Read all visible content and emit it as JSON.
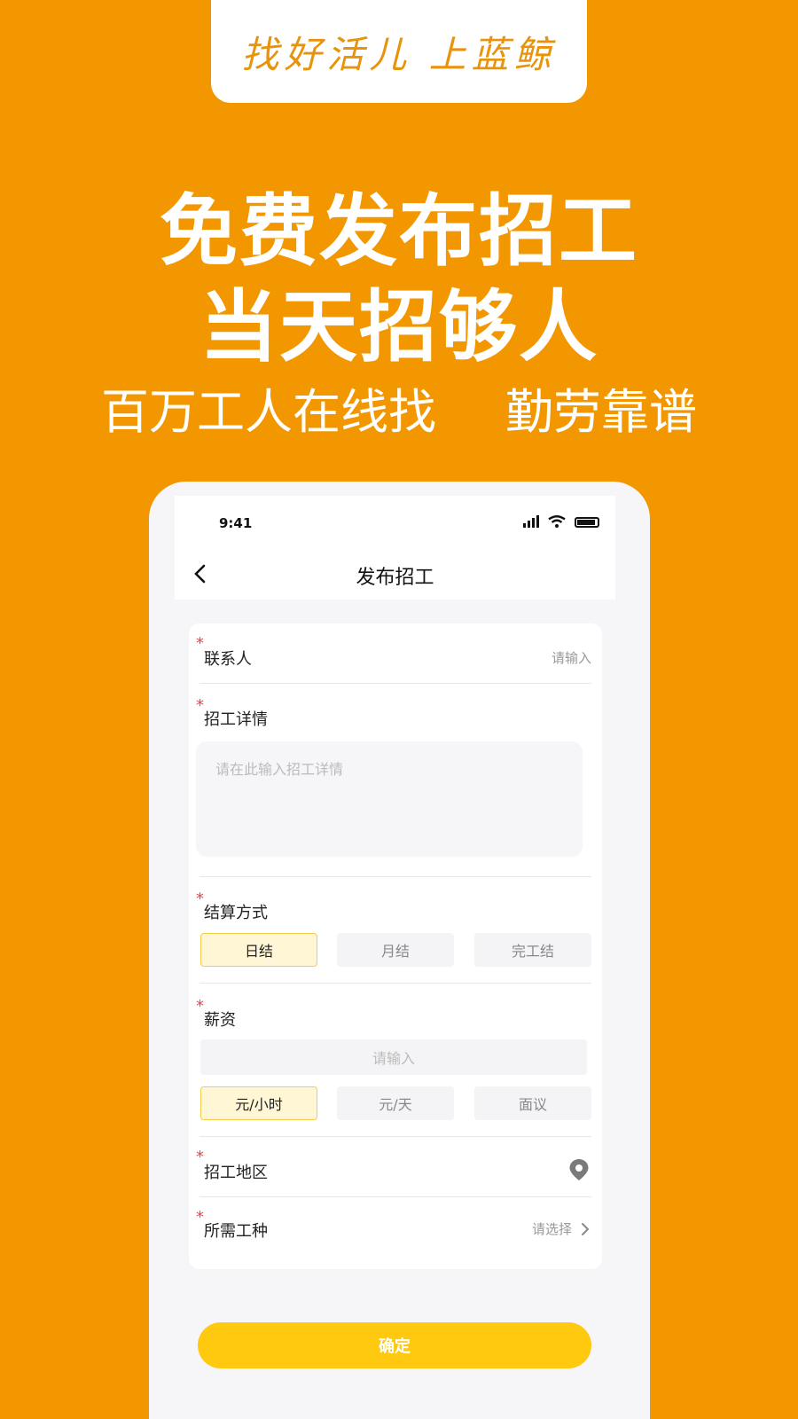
{
  "banner": {
    "slogan": "找好活儿 上蓝鲸",
    "headline_1": "免费发布招工",
    "headline_2": "当天招够人",
    "subline_left": "百万工人在线找",
    "subline_right": "勤劳靠谱"
  },
  "status_bar": {
    "time": "9:41",
    "icons": [
      "signal-icon",
      "wifi-icon",
      "battery-icon"
    ]
  },
  "nav": {
    "title": "发布招工",
    "back_icon": "chevron-left-icon"
  },
  "form": {
    "contact": {
      "label": "联系人",
      "placeholder": "请输入",
      "required_mark": "*"
    },
    "details": {
      "label": "招工详情",
      "placeholder": "请在此输入招工详情",
      "required_mark": "*"
    },
    "settlement": {
      "label": "结算方式",
      "required_mark": "*",
      "options": [
        "日结",
        "月结",
        "完工结"
      ],
      "selected": "日结"
    },
    "salary": {
      "label": "薪资",
      "required_mark": "*",
      "placeholder": "请输入",
      "units": [
        "元/小时",
        "元/天",
        "面议"
      ],
      "selected_unit": "元/小时"
    },
    "region": {
      "label": "招工地区",
      "required_mark": "*",
      "icon": "location-pin-icon"
    },
    "trade": {
      "label": "所需工种",
      "required_mark": "*",
      "placeholder": "请选择",
      "icon": "chevron-right-icon"
    }
  },
  "confirm_label": "确定",
  "colors": {
    "background": "#F29700",
    "accent": "#FEC90E",
    "selected_bg": "#FFF6D5",
    "required": "#EE4444"
  }
}
